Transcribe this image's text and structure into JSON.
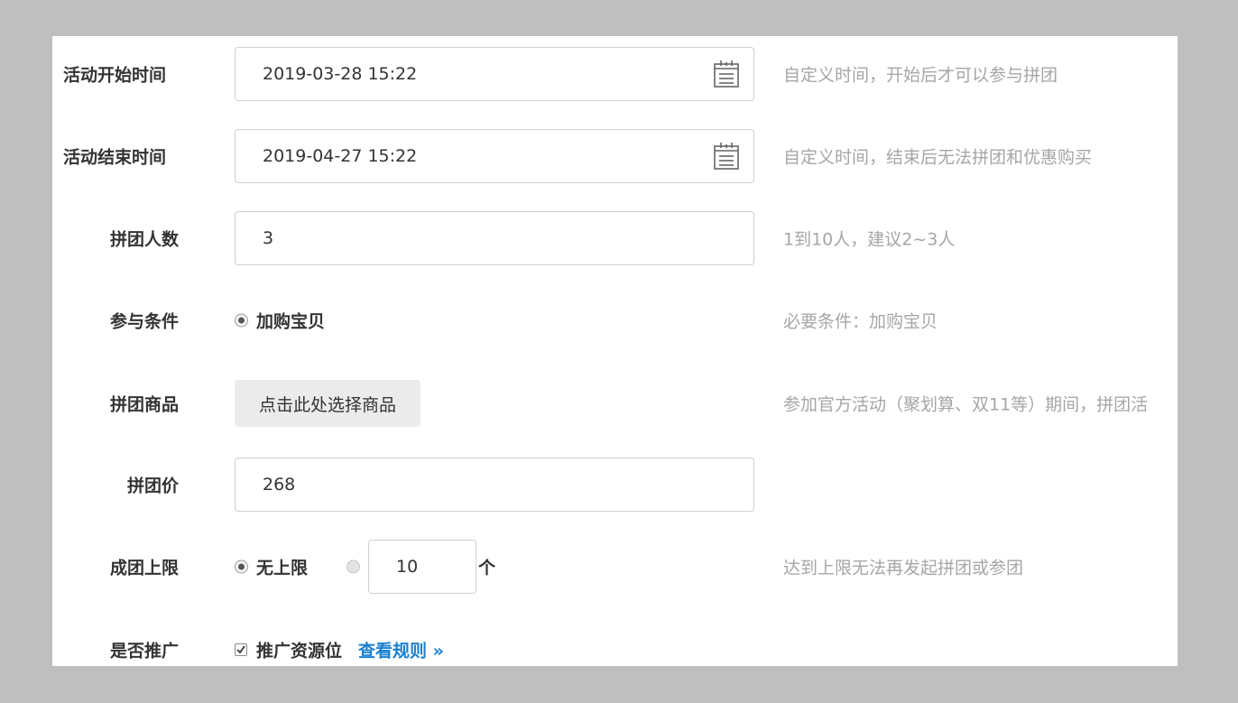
{
  "form": {
    "start_time": {
      "label": "活动开始时间",
      "value": "2019-03-28 15:22",
      "hint": "自定义时间，开始后才可以参与拼团",
      "icon": "calendar-icon"
    },
    "end_time": {
      "label": "活动结束时间",
      "value": "2019-04-27 15:22",
      "hint": "自定义时间，结束后无法拼团和优惠购买",
      "icon": "calendar-icon"
    },
    "group_size": {
      "label": "拼团人数",
      "value": "3",
      "hint": "1到10人，建议2~3人"
    },
    "condition": {
      "label": "参与条件",
      "option": "加购宝贝",
      "checked": true,
      "hint": "必要条件：加购宝贝"
    },
    "product": {
      "label": "拼团商品",
      "button": "点击此处选择商品",
      "hint": "参加官方活动（聚划算、双11等）期间，拼团活"
    },
    "group_price": {
      "label": "拼团价",
      "value": "268"
    },
    "group_limit": {
      "label": "成团上限",
      "option_unlimited": "无上限",
      "unlimited_checked": true,
      "limit_value": "10",
      "unit": "个",
      "hint": "达到上限无法再发起拼团或参团"
    },
    "promote": {
      "label": "是否推广",
      "option": "推广资源位",
      "checked": true,
      "link": "查看规则 »"
    }
  },
  "colors": {
    "background": "#bfbfbf",
    "panel": "#ffffff",
    "hint": "#a6a6a6",
    "link": "#1a7fd0"
  }
}
